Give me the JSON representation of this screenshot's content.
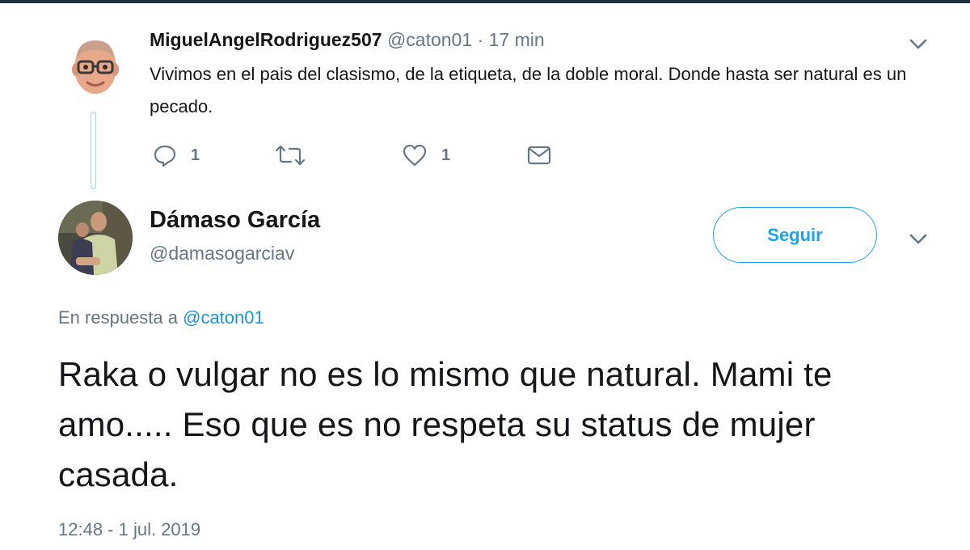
{
  "parent_tweet": {
    "display_name": "MiguelAngelRodriguez507",
    "handle": "@caton01",
    "separator": "·",
    "time": "17 min",
    "text": "Vivimos en el pais del clasismo, de la etiqueta, de la doble moral. Donde hasta ser natural es un pecado.",
    "reply_count": "1",
    "like_count": "1",
    "icons": {
      "reply": "reply-icon",
      "retweet": "retweet-icon",
      "like": "like-icon",
      "message": "direct-message-icon",
      "menu": "chevron-down-icon"
    }
  },
  "main_tweet": {
    "display_name": "Dámaso García",
    "handle": "@damasogarciav",
    "follow_label": "Seguir",
    "reply_prefix": "En respuesta a",
    "reply_handle": "@caton01",
    "text": "Raka o vulgar no es lo mismo que natural. Mami te amo..... Eso que es no respeta su status de mujer casada.",
    "timestamp": "12:48 - 1 jul. 2019",
    "icons": {
      "menu": "chevron-down-icon"
    }
  },
  "colors": {
    "accent": "#1da1f2",
    "link": "#1b95e0",
    "text_primary": "#14171a",
    "text_secondary": "#657786",
    "thread_line": "#9fd2e9",
    "top_border": "#1d2f3d"
  }
}
